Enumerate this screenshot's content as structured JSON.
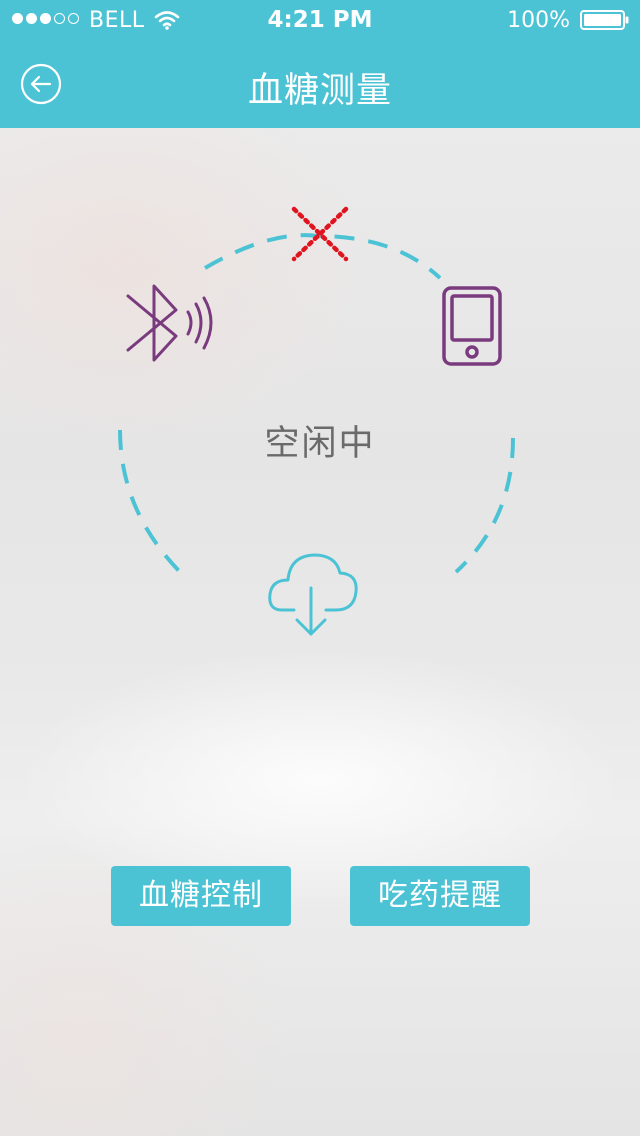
{
  "status_bar": {
    "carrier": "BELL",
    "time": "4:21 PM",
    "battery": "100%",
    "signal_bars": 3,
    "signal_total": 5,
    "icons": [
      "wifi-icon",
      "battery-icon"
    ]
  },
  "nav": {
    "title": "血糖测量",
    "back_icon": "back-arrow-icon"
  },
  "diagram": {
    "status": "空闲中",
    "icons": [
      "bluetooth-icon",
      "disconnected-x-icon",
      "phone-icon",
      "cloud-download-icon"
    ],
    "colors": {
      "dash": "#4cc3d5",
      "device": "#7a3b7e",
      "error": "#e0141e"
    }
  },
  "actions": {
    "glucose_control": "血糖控制",
    "medication_reminder": "吃药提醒"
  },
  "colors": {
    "accent": "#4cc3d5",
    "text_muted": "#6a6a6a"
  }
}
